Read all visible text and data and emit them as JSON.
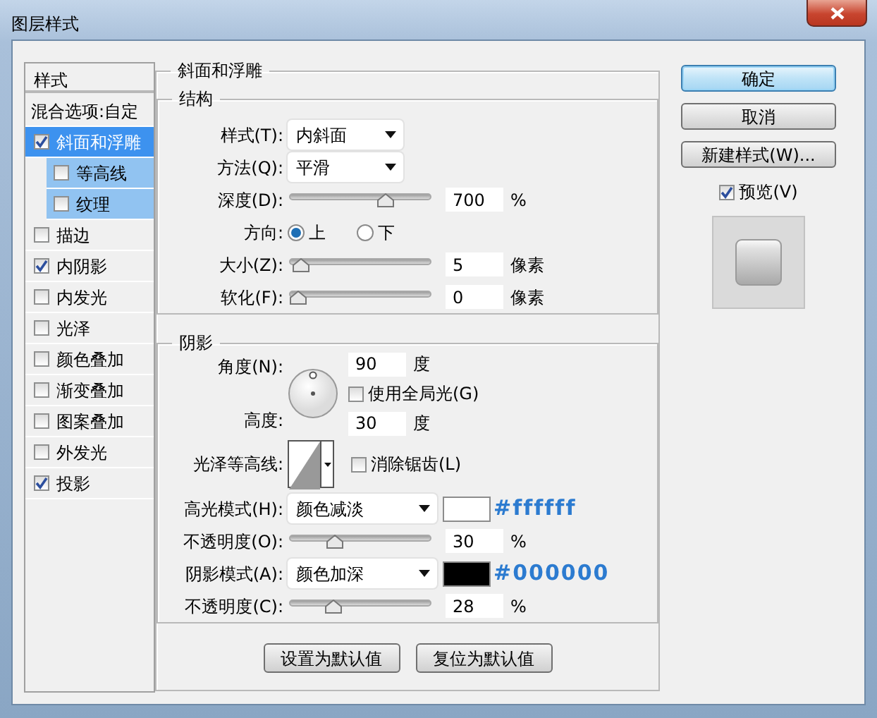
{
  "window": {
    "title": "图层样式"
  },
  "sidebar": {
    "header": "样式",
    "blending": "混合选项:自定",
    "items": [
      {
        "label": "斜面和浮雕",
        "checked": true,
        "selected": true,
        "children": [
          {
            "label": "等高线",
            "checked": false,
            "selected": false
          },
          {
            "label": "纹理",
            "checked": false,
            "selected": false
          }
        ]
      },
      {
        "label": "描边",
        "checked": false,
        "selected": false
      },
      {
        "label": "内阴影",
        "checked": true,
        "selected": false
      },
      {
        "label": "内发光",
        "checked": false,
        "selected": false
      },
      {
        "label": "光泽",
        "checked": false,
        "selected": false
      },
      {
        "label": "颜色叠加",
        "checked": false,
        "selected": false
      },
      {
        "label": "渐变叠加",
        "checked": false,
        "selected": false
      },
      {
        "label": "图案叠加",
        "checked": false,
        "selected": false
      },
      {
        "label": "外发光",
        "checked": false,
        "selected": false
      },
      {
        "label": "投影",
        "checked": true,
        "selected": false
      }
    ]
  },
  "bevel": {
    "title": "斜面和浮雕",
    "structure": {
      "title": "结构",
      "rows": [
        {
          "kind": "select",
          "label": "样式(T):",
          "value": "内斜面"
        },
        {
          "kind": "select",
          "label": "方法(Q):",
          "value": "平滑"
        },
        {
          "kind": "slider",
          "label": "深度(D):",
          "value": "700",
          "unit": "%",
          "level": 0.7
        },
        {
          "kind": "radio",
          "label": "方向:",
          "options": [
            {
              "label": "上",
              "selected": true
            },
            {
              "label": "下",
              "selected": false
            }
          ]
        },
        {
          "kind": "slider",
          "label": "大小(Z):",
          "value": "5",
          "unit": "像素",
          "level": 0.02
        },
        {
          "kind": "slider",
          "label": "软化(F):",
          "value": "0",
          "unit": "像素",
          "level": 0
        }
      ]
    },
    "shading": {
      "title": "阴影",
      "angle": {
        "label": "角度(N):",
        "value": "90",
        "unit": "度"
      },
      "global_light": {
        "label": "使用全局光(G)",
        "checked": false
      },
      "altitude": {
        "label": "高度:",
        "value": "30",
        "unit": "度"
      },
      "gloss_contour": {
        "label": "光泽等高线:"
      },
      "anti_aliased": {
        "label": "消除锯齿(L)",
        "checked": false
      },
      "rows": [
        {
          "kind": "mode",
          "label": "高光模式(H):",
          "value": "颜色减淡",
          "color": "#ffffff",
          "note": "#ffffff"
        },
        {
          "kind": "slider",
          "label": "不透明度(O):",
          "value": "30",
          "unit": "%",
          "level": 0.3
        },
        {
          "kind": "mode",
          "label": "阴影模式(A):",
          "value": "颜色加深",
          "color": "#000000",
          "note": "#000000"
        },
        {
          "kind": "slider",
          "label": "不透明度(C):",
          "value": "28",
          "unit": "%",
          "level": 0.28
        }
      ]
    },
    "buttons": [
      "设置为默认值",
      "复位为默认值"
    ]
  },
  "actions": [
    {
      "label": "确定",
      "default": true
    },
    {
      "label": "取消",
      "default": false
    },
    {
      "label": "新建样式(W)...",
      "default": false
    }
  ],
  "preview": {
    "label": "预览(V)",
    "checked": true
  }
}
